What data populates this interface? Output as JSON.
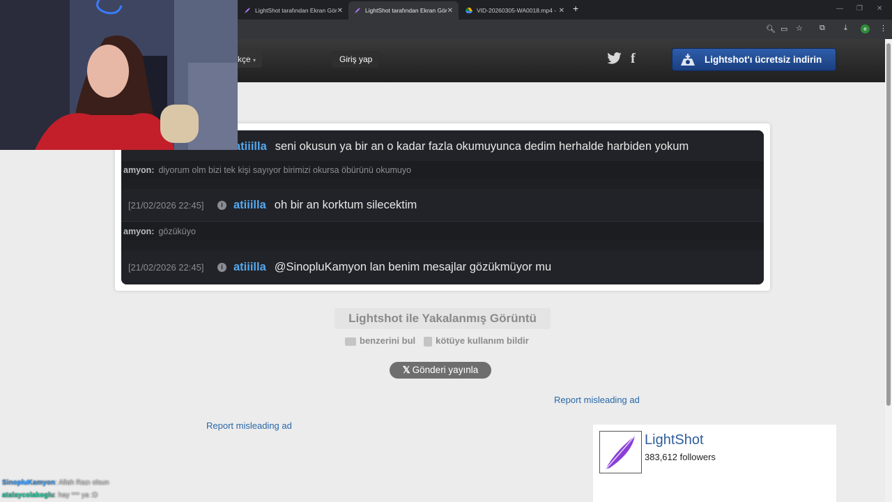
{
  "browser": {
    "tabs": [
      {
        "title": "LightShot tarafından Ekran Gör"
      },
      {
        "title": "LightShot tarafından Ekran Gör"
      },
      {
        "title": "VID-20260305-WA0018.mp4 - "
      }
    ],
    "new_tab": "+",
    "icons": [
      "zoom-icon",
      "cast-icon",
      "star-icon",
      "extensions-icon",
      "download-icon",
      "profile-icon",
      "menu-icon"
    ],
    "profile_letter": "e"
  },
  "header": {
    "language": "kçe",
    "login": "Giriş yap",
    "download_button": "Lightshot'ı ücretsiz indirin",
    "social": [
      "twitter-icon",
      "facebook-icon"
    ],
    "fb_glyph": "f"
  },
  "screenshot": {
    "messages": [
      {
        "timestamp": "",
        "user": "atiiilla",
        "text": "seni okusun ya bir an o kadar fazla okumuyunca dedim herhalde harbiden yokum"
      },
      {
        "timestamp": "[21/02/2026 22:45]",
        "user": "atiiilla",
        "text": "oh bir an korktum silecektim"
      },
      {
        "timestamp": "[21/02/2026 22:45]",
        "user": "atiiilla",
        "text": "@SinopluKamyon lan benim mesajlar gözükmüyor mu"
      }
    ],
    "replies": [
      {
        "who": "amyon:",
        "text": "diyorum olm bizi tek kişi sayıyor birimizi okursa öbürünü okumuyo"
      },
      {
        "who": "amyon:",
        "text": "gözüküyo"
      }
    ],
    "info_glyph": "i"
  },
  "caption": {
    "title": "Lightshot ile Yakalanmış Görüntü",
    "find_similar": "benzerini bul",
    "report_abuse": "kötüye kullanım bildir",
    "post_button": "Gönderi yayınla"
  },
  "ads": {
    "report_right": "Report misleading ad",
    "report_left": "Report misleading ad"
  },
  "fb_widget": {
    "name": "LightShot",
    "followers": "383,612 followers"
  },
  "stream_chat": [
    {
      "user": "SinopluKamyon",
      "message": ": Allah Razı olsun"
    },
    {
      "user": "atalaycolakoglu",
      "message": ": hay *** ya :D"
    }
  ],
  "colors": {
    "accent_blue": "#1b3f80",
    "chat_user": "#54a9f0",
    "link": "#2867a8"
  }
}
